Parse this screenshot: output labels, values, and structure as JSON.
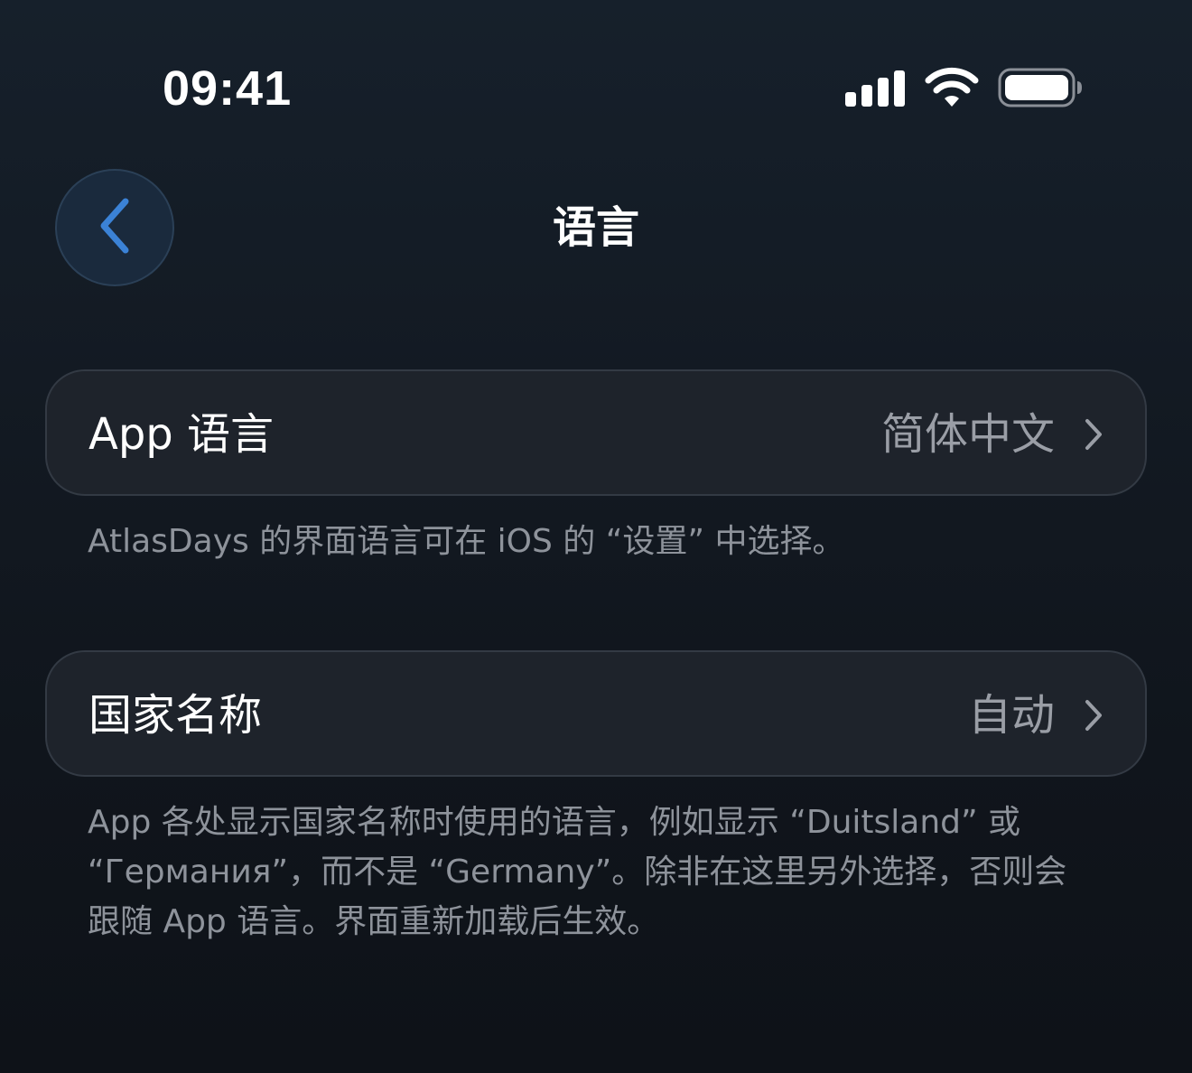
{
  "status_bar": {
    "time": "09:41",
    "icons": [
      "cellular-signal-icon",
      "wifi-icon",
      "battery-icon"
    ]
  },
  "nav": {
    "back_icon": "chevron-left-icon",
    "title": "语言"
  },
  "settings": [
    {
      "label": "App 语言",
      "value": "简体中文",
      "note": "AtlasDays 的界面语言可在 iOS 的 “设置” 中选择。"
    },
    {
      "label": "国家名称",
      "value": "自动",
      "note": "App 各处显示国家名称时使用的语言，例如显示 “Duitsland” 或 “Германия”，而不是 “Germany”。除非在这里另外选择，否则会跟随 App 语言。界面重新加载后生效。"
    }
  ],
  "colors": {
    "accent": "#3b82d6",
    "row_background": "#1e232b",
    "secondary_text": "#9a9ea6"
  }
}
